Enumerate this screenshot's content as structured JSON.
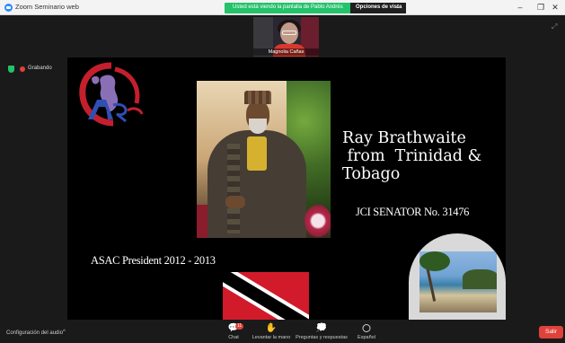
{
  "window": {
    "title": "Zoom Seminario web",
    "minimize_glyph": "–",
    "maximize_glyph": "❐",
    "close_glyph": "✕"
  },
  "share_banner": {
    "text": "Usted está viendo la pantalla de Pablo Andrés",
    "view_options_label": "Opciones de vista",
    "view_options_caret": "⌄"
  },
  "participant": {
    "name": "Magnolia Cañas"
  },
  "recording": {
    "label": "Grabando"
  },
  "slide": {
    "heading": "Ray Brathwaite\n from  Trinidad &\nTobago",
    "senator": "JCI SENATOR No. 31476",
    "president": "ASAC President 2012  - 2013"
  },
  "toolbar": {
    "audio_settings": "Configuración del audio",
    "audio_caret": "^",
    "chat_label": "Chat",
    "chat_badge": "11",
    "raise_hand_label": "Levantar la mano",
    "qa_label": "Preguntas y respuestas",
    "language_label": "Español",
    "leave_label": "Salir"
  },
  "colors": {
    "zoom_blue": "#2d8cff",
    "banner_green": "#23c26b",
    "leave_red": "#e0413b",
    "flag_red": "#d11b2b"
  },
  "icons": [
    "zoom-app-icon",
    "shield-icon",
    "record-icon",
    "chat-icon",
    "raise-hand-icon",
    "qa-icon",
    "globe-icon",
    "expand-icon"
  ]
}
